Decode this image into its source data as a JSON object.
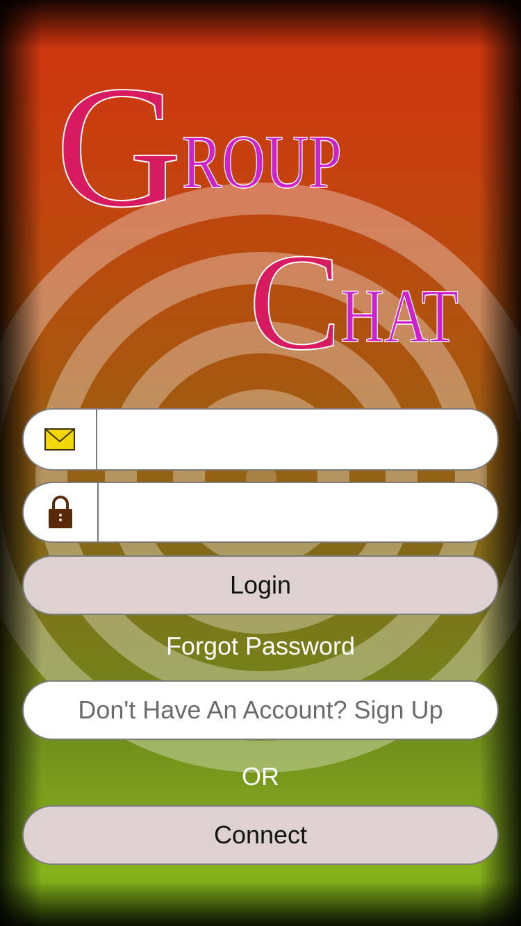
{
  "logo": {
    "line1_initial": "G",
    "line1_rest": "ROUP",
    "line2_initial": "C",
    "line2_rest": "HAT",
    "initial_color": "#d81b60",
    "rest_color": "#cc22cc"
  },
  "email_field": {
    "icon": "envelope-icon",
    "value": "",
    "placeholder": ""
  },
  "password_field": {
    "icon": "lock-icon",
    "value": "",
    "placeholder": ""
  },
  "login_button": {
    "label": "Login"
  },
  "forgot_password": {
    "label": "Forgot Password"
  },
  "signup_button": {
    "label": "Don't Have An Account? Sign Up"
  },
  "or_text": "OR",
  "connect_button": {
    "label": "Connect"
  },
  "colors": {
    "button_fill": "#ddd1d2",
    "field_fill": "#ffffff",
    "border": "#7a7a7a"
  }
}
